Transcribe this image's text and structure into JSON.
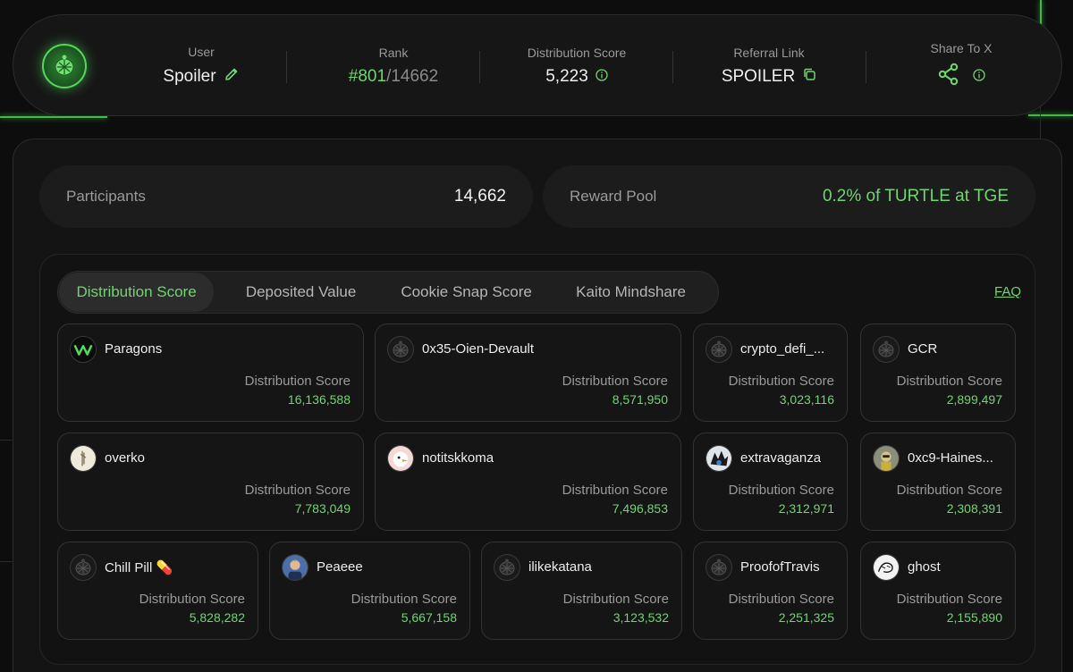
{
  "header": {
    "user_label": "User",
    "user_name": "Spoiler",
    "rank_label": "Rank",
    "rank_value": "#801",
    "rank_total": "/14662",
    "score_label": "Distribution Score",
    "score_value": "5,223",
    "referral_label": "Referral Link",
    "referral_value": "SPOILER",
    "share_label": "Share To X"
  },
  "stats": {
    "participants_label": "Participants",
    "participants_value": "14,662",
    "reward_label": "Reward Pool",
    "reward_value": "0.2% of TURTLE at TGE"
  },
  "tabs": [
    "Distribution Score",
    "Deposited Value",
    "Cookie Snap Score",
    "Kaito Mindshare"
  ],
  "faq_label": "FAQ",
  "card_label": "Distribution Score",
  "leaders": [
    {
      "name": "Paragons",
      "value": "16,136,588",
      "avatar": "paragons-logo-icon"
    },
    {
      "name": "0x35-Oien-Devault",
      "value": "8,571,950",
      "avatar": "turtle-icon"
    },
    {
      "name": "crypto_defi_...",
      "value": "3,023,116",
      "avatar": "turtle-icon"
    },
    {
      "name": "GCR",
      "value": "2,899,497",
      "avatar": "turtle-icon"
    },
    {
      "name": "overko",
      "value": "7,783,049",
      "avatar": "overko-avatar"
    },
    {
      "name": "notitskkoma",
      "value": "7,496,853",
      "avatar": "bird-avatar"
    },
    {
      "name": "extravaganza",
      "value": "2,312,971",
      "avatar": "anime-avatar"
    },
    {
      "name": "0xc9-Haines...",
      "value": "2,308,391",
      "avatar": "character-avatar"
    },
    {
      "name": "Chill Pill 💊",
      "value": "5,828,282",
      "avatar": "turtle-icon"
    },
    {
      "name": "Peaeee",
      "value": "5,667,158",
      "avatar": "person-avatar"
    },
    {
      "name": "ilikekatana",
      "value": "3,123,532",
      "avatar": "turtle-icon"
    },
    {
      "name": "ProofofTravis",
      "value": "2,251,325",
      "avatar": "turtle-icon"
    },
    {
      "name": "ghost",
      "value": "2,155,890",
      "avatar": "ghost-avatar"
    }
  ],
  "colors": {
    "accent": "#6fd66f",
    "background": "#0d0d0d",
    "card": "#151515"
  }
}
